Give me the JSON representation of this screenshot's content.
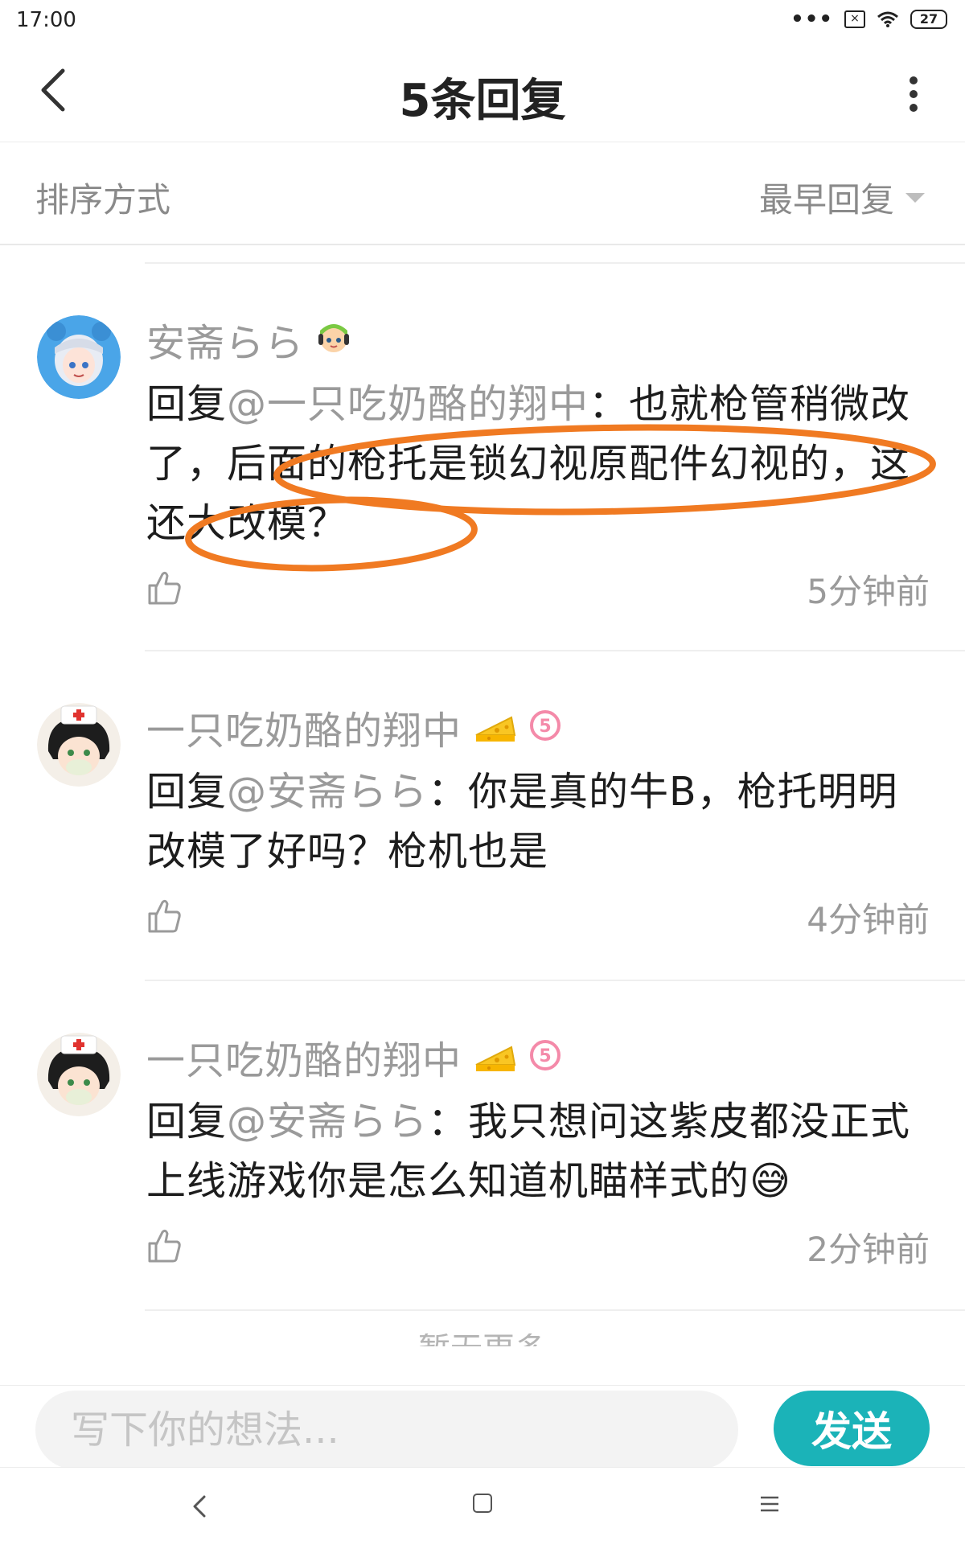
{
  "status_bar": {
    "time": "17:00",
    "more_indicator": "•••",
    "battery": "27"
  },
  "header": {
    "title": "5条回复"
  },
  "sort": {
    "label": "排序方式",
    "value": "最早回复"
  },
  "replies": [
    {
      "username": "安斋らら",
      "reply_prefix": "回复",
      "mention": "@一只吃奶酪的翔中",
      "body": "：也就枪管稍微改了，后面的枪托是锁幻视原配件幻视的，这还大改模？",
      "time": "5分钟前",
      "avatar_icon": "anime-girl-blue-hood-avatar",
      "badge_icon": "green-hair-character-badge"
    },
    {
      "username": "一只吃奶酪的翔中",
      "reply_prefix": "回复",
      "mention": "@安斋らら",
      "body": "：你是真的牛B，枪托明明改模了好吗？枪机也是",
      "time": "4分钟前",
      "avatar_icon": "anime-boy-nurse-cap-avatar",
      "badge_icon": "cheese-emoji",
      "level": "5"
    },
    {
      "username": "一只吃奶酪的翔中",
      "reply_prefix": "回复",
      "mention": "@安斋らら",
      "body": "：我只想问这紫皮都没正式上线游戏你是怎么知道机瞄样式的",
      "time": "2分钟前",
      "avatar_icon": "anime-boy-nurse-cap-avatar",
      "badge_icon": "cheese-emoji",
      "level": "5",
      "emoji": "😅"
    }
  ],
  "more_hint": "暂无更多",
  "composer": {
    "placeholder": "写下你的想法...",
    "send_label": "发送"
  },
  "colors": {
    "accent": "#1bb3b8",
    "highlight": "#f07a22",
    "muted_text": "#9a9a9a"
  }
}
